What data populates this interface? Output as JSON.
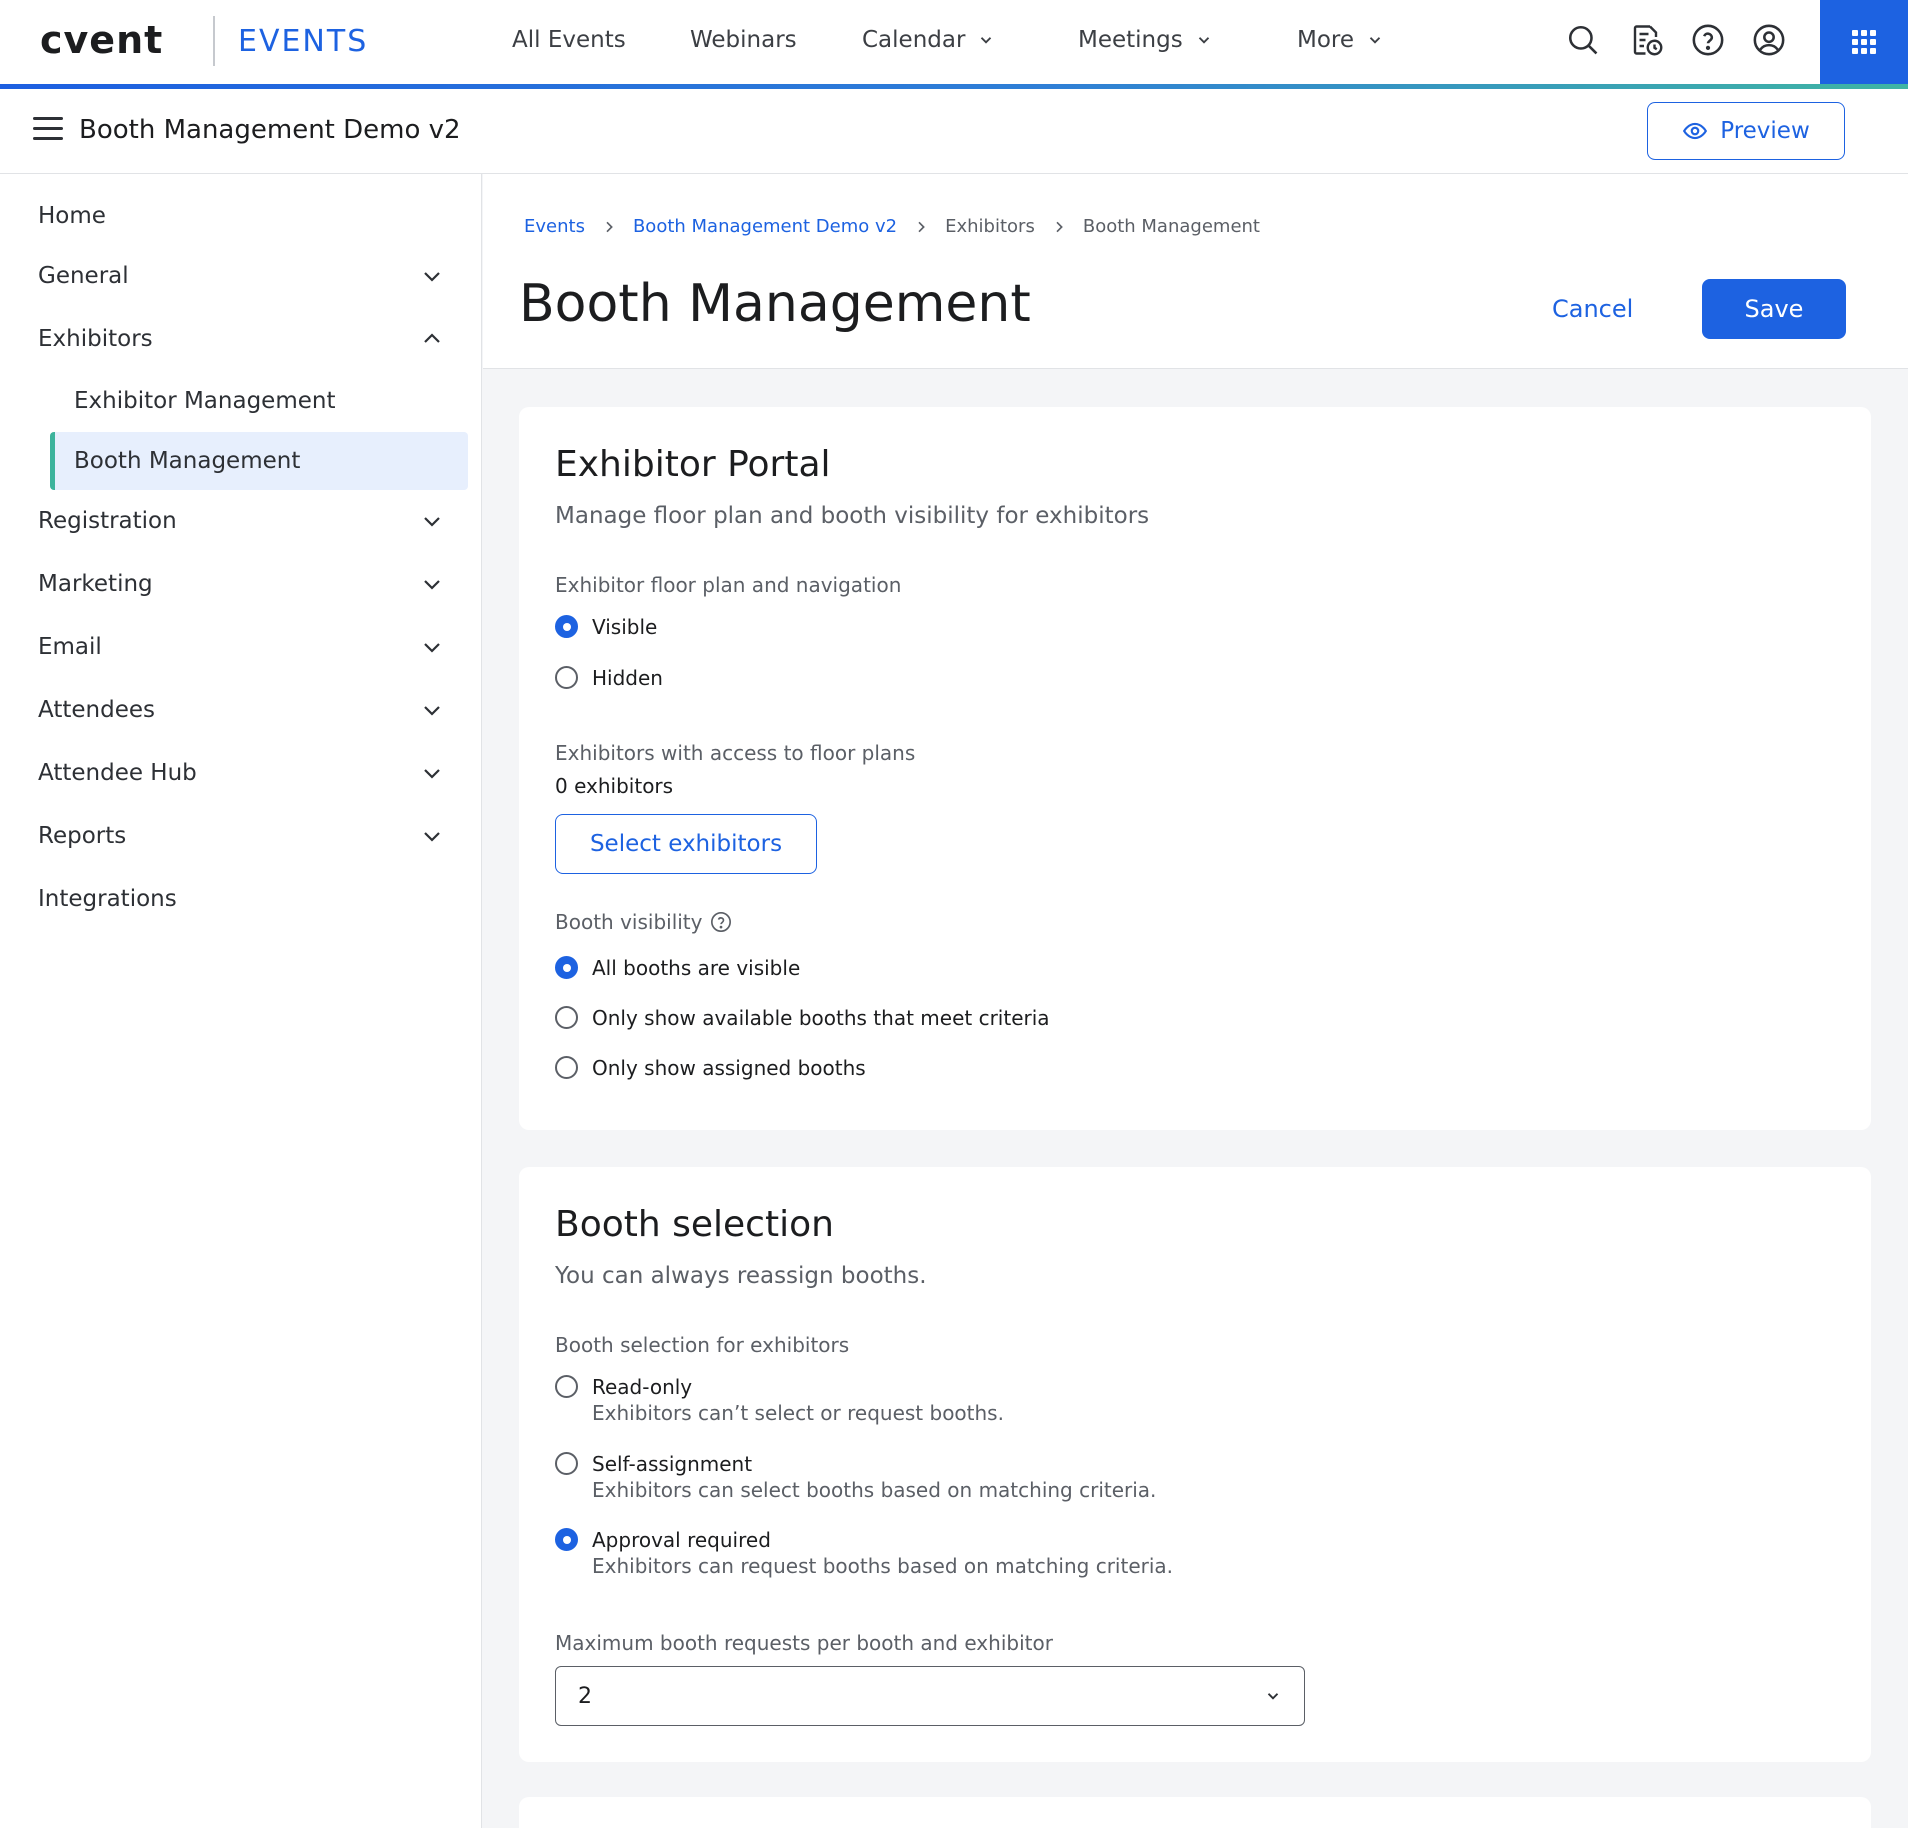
{
  "brand": {
    "logo_text": "cvent",
    "app_name": "EVENTS",
    "accent_color": "#1d62e1",
    "active_indicator_color": "#3cb39c"
  },
  "topnav": {
    "items": [
      {
        "label": "All Events"
      },
      {
        "label": "Webinars"
      },
      {
        "label": "Calendar"
      },
      {
        "label": "Meetings"
      },
      {
        "label": "More"
      }
    ],
    "icons": [
      "search-icon",
      "calendar-clock-icon",
      "help-icon",
      "account-icon",
      "apps-grid-icon"
    ]
  },
  "event_bar": {
    "title": "Booth Management Demo v2",
    "preview_label": "Preview"
  },
  "sidebar": {
    "items": [
      {
        "label": "Home"
      },
      {
        "label": "General"
      },
      {
        "label": "Exhibitors"
      },
      {
        "label": "Exhibitor Management"
      },
      {
        "label": "Booth Management"
      },
      {
        "label": "Registration"
      },
      {
        "label": "Marketing"
      },
      {
        "label": "Email"
      },
      {
        "label": "Attendees"
      },
      {
        "label": "Attendee Hub"
      },
      {
        "label": "Reports"
      },
      {
        "label": "Integrations"
      }
    ],
    "active": "Booth Management"
  },
  "breadcrumb": [
    "Events",
    "Booth Management Demo v2",
    "Exhibitors",
    "Booth Management"
  ],
  "page": {
    "title": "Booth Management",
    "cancel_label": "Cancel",
    "save_label": "Save"
  },
  "exhibitor_portal": {
    "title": "Exhibitor Portal",
    "subtitle": "Manage floor plan and booth visibility for exhibitors",
    "floor_plan_label": "Exhibitor floor plan and navigation",
    "floor_plan_options": [
      {
        "label": "Visible",
        "checked": true
      },
      {
        "label": "Hidden",
        "checked": false
      }
    ],
    "access_label": "Exhibitors with access to floor plans",
    "access_value": "0 exhibitors",
    "select_button": "Select exhibitors",
    "visibility_label": "Booth visibility",
    "visibility_options": [
      {
        "label": "All booths are visible",
        "checked": true
      },
      {
        "label": "Only show available booths that meet criteria",
        "checked": false
      },
      {
        "label": "Only show assigned booths",
        "checked": false
      }
    ]
  },
  "booth_selection": {
    "title": "Booth selection",
    "subtitle": "You can always reassign booths.",
    "selection_label": "Booth selection for exhibitors",
    "options": [
      {
        "label": "Read-only",
        "description": "Exhibitors can’t select or request booths.",
        "checked": false
      },
      {
        "label": "Self-assignment",
        "description": "Exhibitors can select booths based on matching criteria.",
        "checked": false
      },
      {
        "label": "Approval required",
        "description": "Exhibitors can request booths based on matching criteria.",
        "checked": true
      }
    ],
    "max_requests_label": "Maximum booth requests per booth and exhibitor",
    "max_requests_value": "2"
  }
}
